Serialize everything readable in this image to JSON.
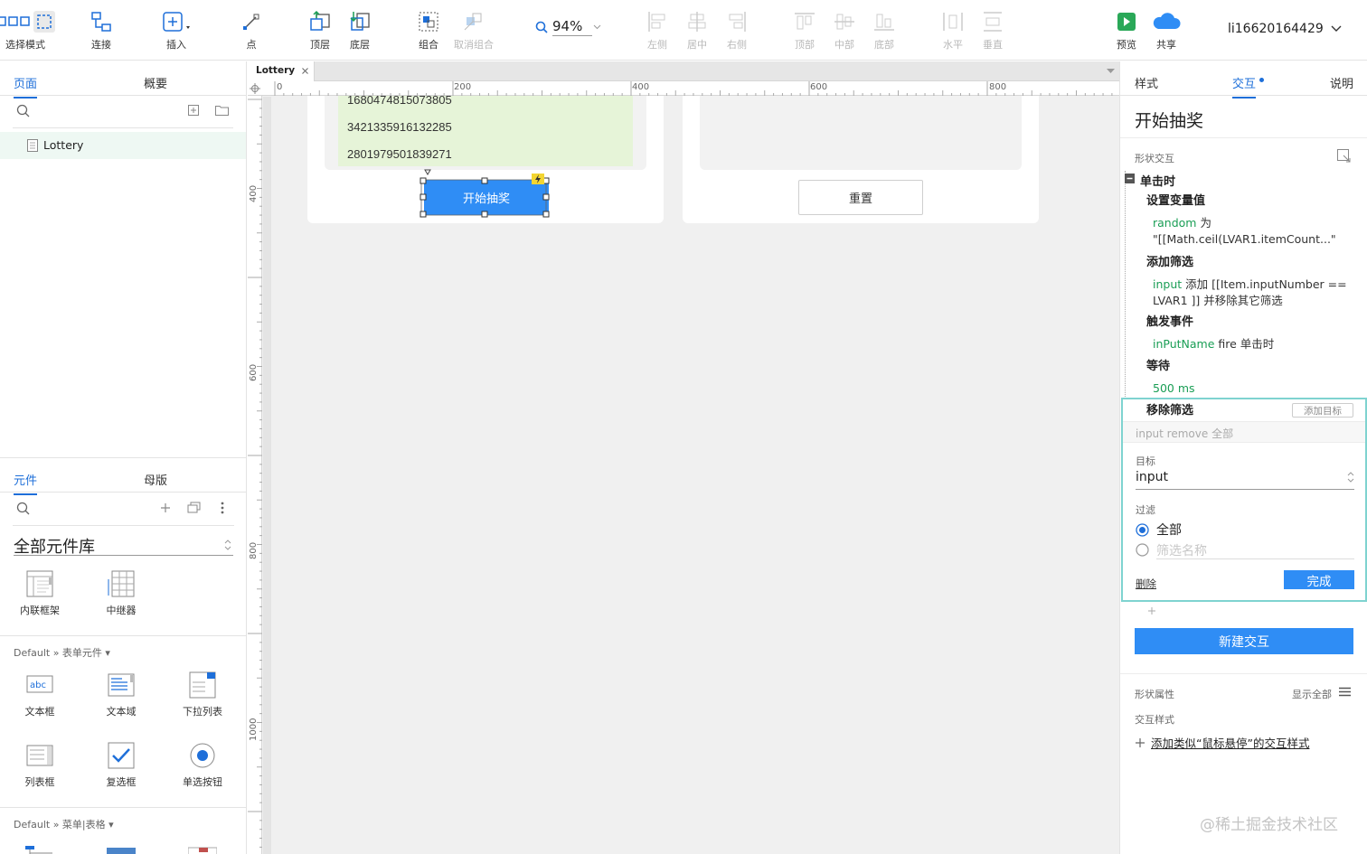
{
  "toolbar": {
    "select_mode": "选择模式",
    "connect": "连接",
    "insert": "插入",
    "point": "点",
    "top_layer": "顶层",
    "bottom_layer": "底层",
    "group": "组合",
    "ungroup": "取消组合",
    "zoom": "94%",
    "align_left": "左侧",
    "align_center": "居中",
    "align_right": "右侧",
    "align_top": "顶部",
    "align_middle": "中部",
    "align_bottom": "底部",
    "distribute_h": "水平",
    "distribute_v": "垂直",
    "preview": "预览",
    "share": "共享",
    "user": "li16620164429"
  },
  "left": {
    "tabs": [
      "页面",
      "概要"
    ],
    "pages": [
      {
        "name": "Lottery"
      }
    ],
    "lib_tabs": [
      "元件",
      "母版"
    ],
    "library_select": "全部元件库",
    "top_components": [
      {
        "label": "内联框架",
        "icon": "inline-frame"
      },
      {
        "label": "中继器",
        "icon": "repeater"
      }
    ],
    "section_form": "Default » 表单元件",
    "form_components": [
      {
        "label": "文本框",
        "icon": "text-field"
      },
      {
        "label": "文本域",
        "icon": "text-area"
      },
      {
        "label": "下拉列表",
        "icon": "dropdown"
      },
      {
        "label": "列表框",
        "icon": "list-box"
      },
      {
        "label": "复选框",
        "icon": "checkbox"
      },
      {
        "label": "单选按钮",
        "icon": "radio-button"
      }
    ],
    "section_menu": "Default » 菜单|表格"
  },
  "canvas": {
    "tab_title": "Lottery",
    "ruler_h": [
      "0",
      "200",
      "400",
      "600",
      "800"
    ],
    "ruler_v": [
      "400",
      "600",
      "800",
      "1000"
    ],
    "numbers": [
      "1680474815073805",
      "3421335916132285",
      "2801979501839271"
    ],
    "start_button": "开始抽奖",
    "reset_button": "重置",
    "colors": {
      "accent": "#2f8df5",
      "green_box": "#e6f4d8",
      "canvas_bg": "#f0f0f0"
    }
  },
  "right": {
    "tabs": [
      "样式",
      "交互",
      "说明"
    ],
    "title": "开始抽奖",
    "shape_interaction": "形状交互",
    "event": "单击时",
    "actions": [
      {
        "head": "设置变量值",
        "lines": [
          {
            "g": "random",
            "t": " 为"
          },
          {
            "g": "",
            "t": "\"[[Math.ceil(LVAR1.itemCount...\""
          }
        ]
      },
      {
        "head": "添加筛选",
        "lines": [
          {
            "g": "input",
            "t": " 添加 [[Item.inputNumber =="
          },
          {
            "g": "",
            "t": "LVAR1 ]] 并移除其它筛选"
          }
        ]
      },
      {
        "head": "触发事件",
        "lines": [
          {
            "g": "inPutName",
            "t": " fire 单击时"
          }
        ]
      },
      {
        "head": "等待",
        "lines": [
          {
            "g": "500 ms",
            "t": ""
          }
        ]
      }
    ],
    "remove_filter": {
      "head": "移除筛选",
      "add_target": "添加目标",
      "summary": "input remove 全部",
      "target_label": "目标",
      "target_value": "input",
      "filter_label": "过滤",
      "opt_all": "全部",
      "opt_name_placeholder": "筛选名称",
      "delete": "删除",
      "done": "完成"
    },
    "new_interaction": "新建交互",
    "shape_props": "形状属性",
    "show_all": "显示全部",
    "interaction_style": "交互样式",
    "add_style": "添加类似“鼠标悬停”的交互样式"
  },
  "watermark": "@稀土掘金技术社区"
}
